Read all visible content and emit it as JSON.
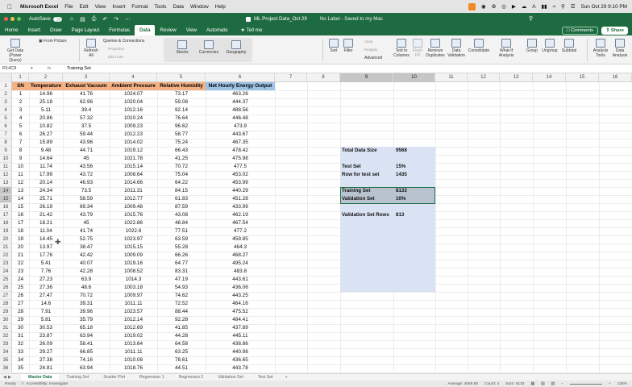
{
  "menubar": {
    "app_name": "Microsoft Excel",
    "items": [
      "File",
      "Edit",
      "View",
      "Insert",
      "Format",
      "Tools",
      "Data",
      "Window",
      "Help"
    ],
    "datetime": "Sun Oct 29 9:10 PM"
  },
  "titlebar": {
    "autosave": "AutoSave",
    "doc_title": "ML Project Data_Oct 29",
    "label_info": "No Label - Saved to my Mac"
  },
  "ribbon_tabs": {
    "tabs": [
      "Home",
      "Insert",
      "Draw",
      "Page Layout",
      "Formulas",
      "Data",
      "Review",
      "View",
      "Automate"
    ],
    "active": "Data",
    "tell_me": "Tell me",
    "comments": "Comments",
    "share": "Share"
  },
  "ribbon": {
    "get_data": "Get Data (Power Query)",
    "from_picture": "From Picture",
    "refresh_all": "Refresh All",
    "queries": "Queries & Connections",
    "properties": "Properties",
    "edit_links": "Edit Links",
    "stocks": "Stocks",
    "currencies": "Currencies",
    "geography": "Geography",
    "sort": "Sort",
    "filter": "Filter",
    "clear": "Clear",
    "reapply": "Reapply",
    "advanced": "Advanced",
    "text_to_columns": "Text to Columns",
    "flash_fill": "Flash Fill",
    "remove_duplicates": "Remove Duplicates",
    "data_validation": "Data Validation",
    "consolidate": "Consolidate",
    "what_if": "What-If Analysis",
    "group": "Group",
    "ungroup": "Ungroup",
    "subtotal": "Subtotal",
    "analysis_tools": "Analysis Tools",
    "data_analysis": "Data Analysis"
  },
  "formula_bar": {
    "name_box": "R14C9",
    "fx": "fx",
    "content": "Training Set"
  },
  "columns": [
    "1",
    "2",
    "3",
    "4",
    "5",
    "6",
    "7",
    "8",
    "9",
    "10",
    "11",
    "12",
    "13",
    "14",
    "15",
    "16"
  ],
  "headers": [
    "SN",
    "Temperature",
    "Exhaust Vacuum",
    "Ambient Pressure",
    "Relative Humidity",
    "Net Hourly Energy Output"
  ],
  "rows": [
    [
      "1",
      "14.96",
      "41.76",
      "1024.07",
      "73.17",
      "463.26"
    ],
    [
      "2",
      "25.18",
      "62.96",
      "1020.04",
      "59.08",
      "444.37"
    ],
    [
      "3",
      "5.11",
      "39.4",
      "1012.16",
      "92.14",
      "488.56"
    ],
    [
      "4",
      "20.86",
      "57.32",
      "1010.24",
      "76.64",
      "446.48"
    ],
    [
      "5",
      "10.82",
      "37.5",
      "1009.23",
      "96.62",
      "473.9"
    ],
    [
      "6",
      "26.27",
      "59.44",
      "1012.23",
      "58.77",
      "443.67"
    ],
    [
      "7",
      "15.89",
      "43.96",
      "1014.02",
      "75.24",
      "467.35"
    ],
    [
      "8",
      "9.48",
      "44.71",
      "1019.12",
      "66.43",
      "478.42"
    ],
    [
      "9",
      "14.64",
      "45",
      "1021.78",
      "41.25",
      "475.98"
    ],
    [
      "10",
      "11.74",
      "43.56",
      "1015.14",
      "70.72",
      "477.5"
    ],
    [
      "11",
      "17.99",
      "43.72",
      "1008.64",
      "75.04",
      "453.02"
    ],
    [
      "12",
      "20.14",
      "46.93",
      "1014.66",
      "64.22",
      "453.99"
    ],
    [
      "13",
      "24.34",
      "73.5",
      "1011.31",
      "84.15",
      "440.29"
    ],
    [
      "14",
      "25.71",
      "58.59",
      "1012.77",
      "61.83",
      "451.28"
    ],
    [
      "15",
      "26.19",
      "69.34",
      "1009.48",
      "87.59",
      "433.99"
    ],
    [
      "16",
      "21.42",
      "43.79",
      "1015.76",
      "43.08",
      "462.19"
    ],
    [
      "17",
      "18.21",
      "45",
      "1022.86",
      "48.84",
      "467.54"
    ],
    [
      "18",
      "11.04",
      "41.74",
      "1022.6",
      "77.51",
      "477.2"
    ],
    [
      "19",
      "14.45",
      "52.75",
      "1023.97",
      "63.59",
      "459.85"
    ],
    [
      "20",
      "13.97",
      "38.47",
      "1015.15",
      "55.28",
      "464.3"
    ],
    [
      "21",
      "17.76",
      "42.42",
      "1009.09",
      "66.26",
      "468.27"
    ],
    [
      "22",
      "5.41",
      "40.07",
      "1019.16",
      "64.77",
      "495.24"
    ],
    [
      "23",
      "7.76",
      "42.28",
      "1008.52",
      "83.31",
      "483.8"
    ],
    [
      "24",
      "27.23",
      "63.9",
      "1014.3",
      "47.19",
      "443.61"
    ],
    [
      "25",
      "27.36",
      "48.6",
      "1003.18",
      "54.93",
      "436.06"
    ],
    [
      "26",
      "27.47",
      "70.72",
      "1009.97",
      "74.62",
      "443.25"
    ],
    [
      "27",
      "14.6",
      "39.31",
      "1011.11",
      "72.52",
      "464.16"
    ],
    [
      "28",
      "7.91",
      "39.96",
      "1023.57",
      "88.44",
      "475.52"
    ],
    [
      "29",
      "5.81",
      "35.79",
      "1012.14",
      "92.28",
      "484.41"
    ],
    [
      "30",
      "30.53",
      "65.18",
      "1012.69",
      "41.85",
      "437.89"
    ],
    [
      "31",
      "23.87",
      "63.94",
      "1019.02",
      "44.28",
      "445.11"
    ],
    [
      "32",
      "26.09",
      "58.41",
      "1013.64",
      "64.58",
      "438.86"
    ],
    [
      "33",
      "29.27",
      "66.85",
      "1011.11",
      "63.25",
      "440.98"
    ],
    [
      "34",
      "27.38",
      "74.16",
      "1010.08",
      "78.61",
      "436.65"
    ],
    [
      "35",
      "24.81",
      "63.94",
      "1018.76",
      "44.51",
      "443.78"
    ]
  ],
  "summary": {
    "total_label": "Total Data Size",
    "total_value": "9568",
    "test_label": "Test Set",
    "test_value": "15%",
    "row_test_label": "Row for test set",
    "row_test_value": "1435",
    "train_label": "Training Set",
    "train_value": "8133",
    "val_label": "Validation Set",
    "val_value": "10%",
    "val_rows_label": "Validation Set Rows",
    "val_rows_value": "813"
  },
  "sheet_tabs": [
    "Master Data",
    "Training Set",
    "Scatter Plot",
    "Regression 1",
    "Regression 2",
    "Validation Set",
    "Test Set"
  ],
  "active_sheet": "Master Data",
  "status": {
    "ready": "Ready",
    "accessibility": "Accessibility: Investigate",
    "average": "Average: 4066.55",
    "count": "Count: 4",
    "sum": "Sum: 8133",
    "zoom": "138%"
  },
  "colors": {
    "excel_green": "#1f6b41",
    "header_orange": "#f4b183",
    "header_blue": "#9dc3e6",
    "summary_fill": "#dae3f3"
  }
}
